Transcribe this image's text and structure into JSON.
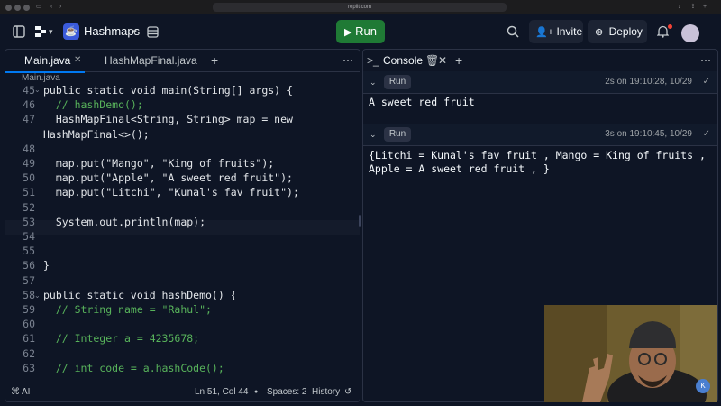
{
  "browser": {
    "url": "replit.com"
  },
  "topbar": {
    "repl_name": "Hashmaps",
    "run_label": "Run",
    "invite_label": "Invite",
    "deploy_label": "Deploy"
  },
  "editor": {
    "tabs": [
      {
        "label": "Main.java"
      },
      {
        "label": "HashMapFinal.java"
      }
    ],
    "breadcrumb": "Main.java",
    "lines": [
      {
        "num": "45",
        "code": "public static void main(String[] args) {"
      },
      {
        "num": "46",
        "code": "  // hashDemo();"
      },
      {
        "num": "47",
        "code": "  HashMapFinal<String, String> map = new"
      },
      {
        "num": "",
        "code": "HashMapFinal<>();"
      },
      {
        "num": "48",
        "code": ""
      },
      {
        "num": "49",
        "code": "  map.put(\"Mango\", \"King of fruits\");"
      },
      {
        "num": "50",
        "code": "  map.put(\"Apple\", \"A sweet red fruit\");"
      },
      {
        "num": "51",
        "code": "  map.put(\"Litchi\", \"Kunal's fav fruit\");"
      },
      {
        "num": "52",
        "code": ""
      },
      {
        "num": "53",
        "code": "  System.out.println(map);"
      },
      {
        "num": "54",
        "code": ""
      },
      {
        "num": "55",
        "code": ""
      },
      {
        "num": "56",
        "code": "}"
      },
      {
        "num": "57",
        "code": ""
      },
      {
        "num": "58",
        "code": "public static void hashDemo() {"
      },
      {
        "num": "59",
        "code": "  // String name = \"Rahul\";"
      },
      {
        "num": "60",
        "code": ""
      },
      {
        "num": "61",
        "code": "  // Integer a = 4235678;"
      },
      {
        "num": "62",
        "code": ""
      },
      {
        "num": "63",
        "code": "  // int code = a.hashCode();"
      }
    ],
    "status": {
      "ai_label": "AI",
      "cursor": "Ln 51, Col 44",
      "spaces": "Spaces: 2",
      "history": "History"
    }
  },
  "console": {
    "tab_label": "Console",
    "runs": [
      {
        "pill": "Run",
        "time": "2s on 19:10:28, 10/29",
        "output": "A sweet red fruit"
      },
      {
        "pill": "Run",
        "time": "3s on 19:10:45, 10/29",
        "output": "{Litchi = Kunal's fav fruit , Mango = King of fruits , Apple = A sweet red fruit , }"
      }
    ]
  }
}
